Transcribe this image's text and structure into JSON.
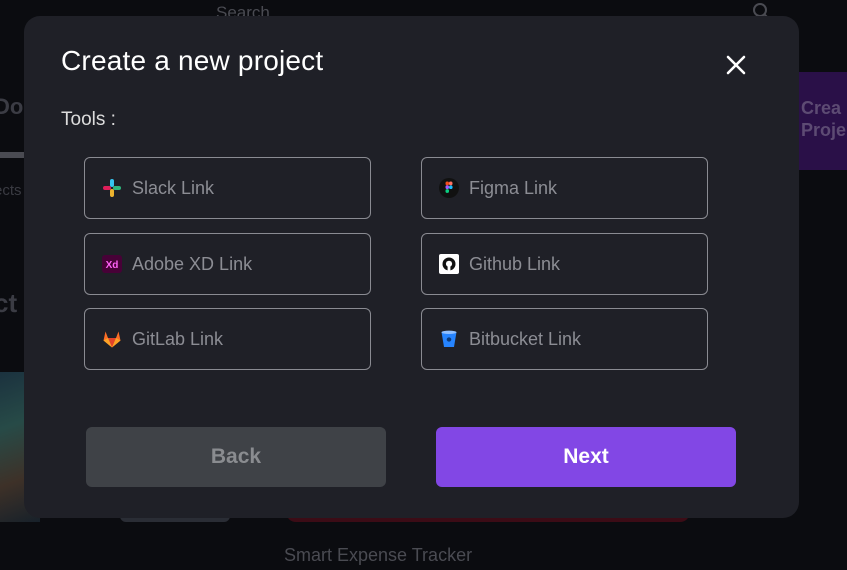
{
  "background": {
    "search_placeholder": "Search",
    "left_fragment_1": "Do",
    "left_fragment_2": "ects",
    "left_fragment_3": "ct",
    "create_button_line1": "Crea",
    "create_button_line2": "Proje",
    "project_title": "Smart Expense Tracker"
  },
  "modal": {
    "title": "Create a new project",
    "tools_label": "Tools :",
    "tools": [
      {
        "label": "Slack Link",
        "icon": "slack-icon"
      },
      {
        "label": "Figma Link",
        "icon": "figma-icon"
      },
      {
        "label": "Adobe XD Link",
        "icon": "adobe-xd-icon"
      },
      {
        "label": "Github Link",
        "icon": "github-icon"
      },
      {
        "label": "GitLab Link",
        "icon": "gitlab-icon"
      },
      {
        "label": "Bitbucket Link",
        "icon": "bitbucket-icon"
      }
    ],
    "xd_icon_text": "Xd",
    "back_label": "Back",
    "next_label": "Next"
  },
  "colors": {
    "modal_bg": "#1f2027",
    "accent": "#8247e5",
    "back_button": "#3f4247",
    "input_border": "#8a8b92"
  }
}
